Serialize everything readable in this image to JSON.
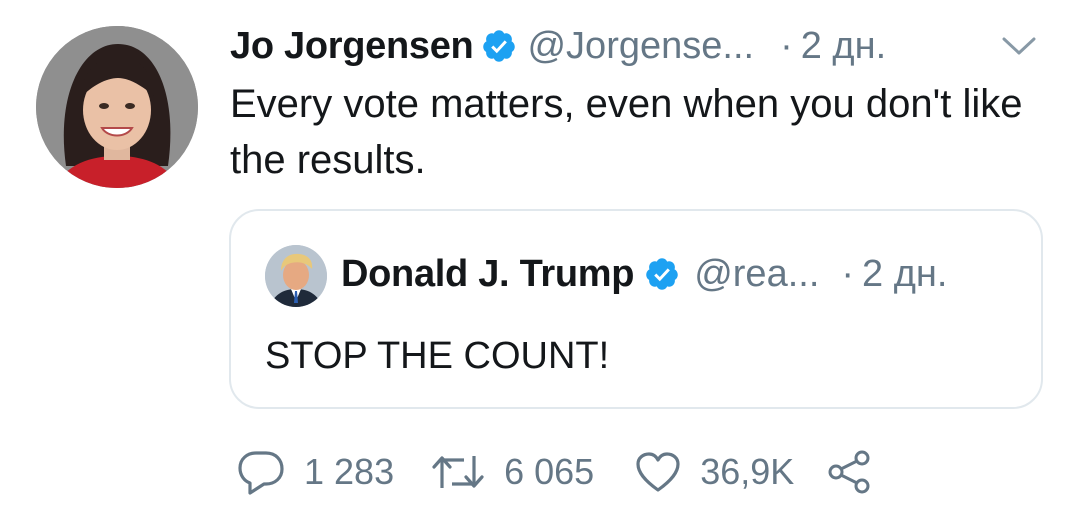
{
  "tweet": {
    "author_name": "Jo Jorgensen",
    "handle": "@Jorgense...",
    "dot": "·",
    "time": "2 дн.",
    "text": "Every vote matters, even when you don't like the results."
  },
  "quoted_tweet": {
    "author_name": "Donald J. Trump",
    "handle": "@rea...",
    "dot": "·",
    "time": "2 дн.",
    "text": "STOP THE COUNT!"
  },
  "actions": {
    "replies": "1 283",
    "retweets": "6 065",
    "likes": "36,9K"
  },
  "icons": {
    "verified": "verified-badge-icon",
    "menu": "chevron-down-icon",
    "reply": "reply-icon",
    "retweet": "retweet-icon",
    "like": "heart-icon",
    "share": "share-icon"
  },
  "colors": {
    "text_primary": "#14171a",
    "text_secondary": "#657786",
    "verified_blue": "#1da1f2",
    "border": "#e1e8ed"
  }
}
